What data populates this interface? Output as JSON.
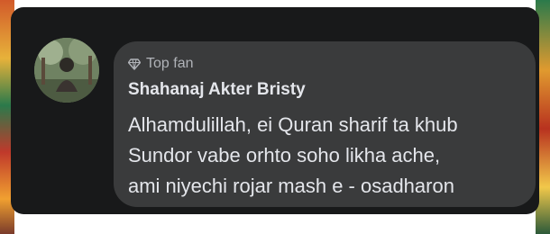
{
  "comment": {
    "badge": {
      "icon": "diamond-icon",
      "label": "Top fan"
    },
    "author": "Shahanaj Akter Bristy",
    "text_lines": [
      "Alhamdulillah, ei Quran sharif ta khub",
      "Sundor vabe orhto soho likha ache,",
      "ami niyechi rojar mash e - osadharon"
    ]
  },
  "colors": {
    "panel_background": "#18191a",
    "bubble_background": "#3a3b3c",
    "primary_text": "#e4e6eb",
    "secondary_text": "#b0b3b8"
  }
}
